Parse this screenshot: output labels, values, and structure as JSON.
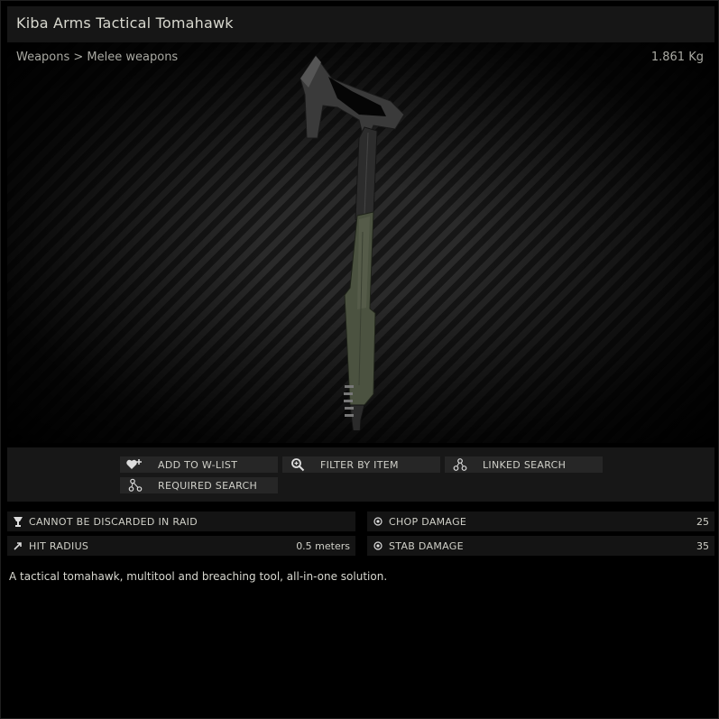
{
  "title": "Kiba Arms Tactical Tomahawk",
  "breadcrumb": "Weapons > Melee weapons",
  "weight": "1.861 Kg",
  "actions": {
    "add_to_wlist": "ADD TO W-LIST",
    "filter_by_item": "FILTER BY ITEM",
    "linked_search": "LINKED SEARCH",
    "required_search": "REQUIRED SEARCH"
  },
  "properties": {
    "discard": {
      "label": "CANNOT BE DISCARDED IN RAID",
      "value": ""
    },
    "hit_radius": {
      "label": "HIT RADIUS",
      "value": "0.5 meters"
    },
    "chop_damage": {
      "label": "CHOP DAMAGE",
      "value": "25"
    },
    "stab_damage": {
      "label": "STAB DAMAGE",
      "value": "35"
    }
  },
  "description": "A tactical tomahawk, multitool and breaching tool, all-in-one solution.",
  "icons": {
    "add_to_wlist": "heart-plus-icon",
    "filter_by_item": "magnifier-plus-icon",
    "linked_search": "linked-nodes-icon",
    "required_search": "required-nodes-icon",
    "discard": "goblet-icon",
    "hit_radius": "arrow-diagonal-icon",
    "chop_damage": "target-icon",
    "stab_damage": "target-icon"
  },
  "colors": {
    "background": "#000000",
    "panel": "#161616",
    "button": "#262626",
    "text": "#d0d0c8",
    "handle_green": "#4b5240"
  }
}
